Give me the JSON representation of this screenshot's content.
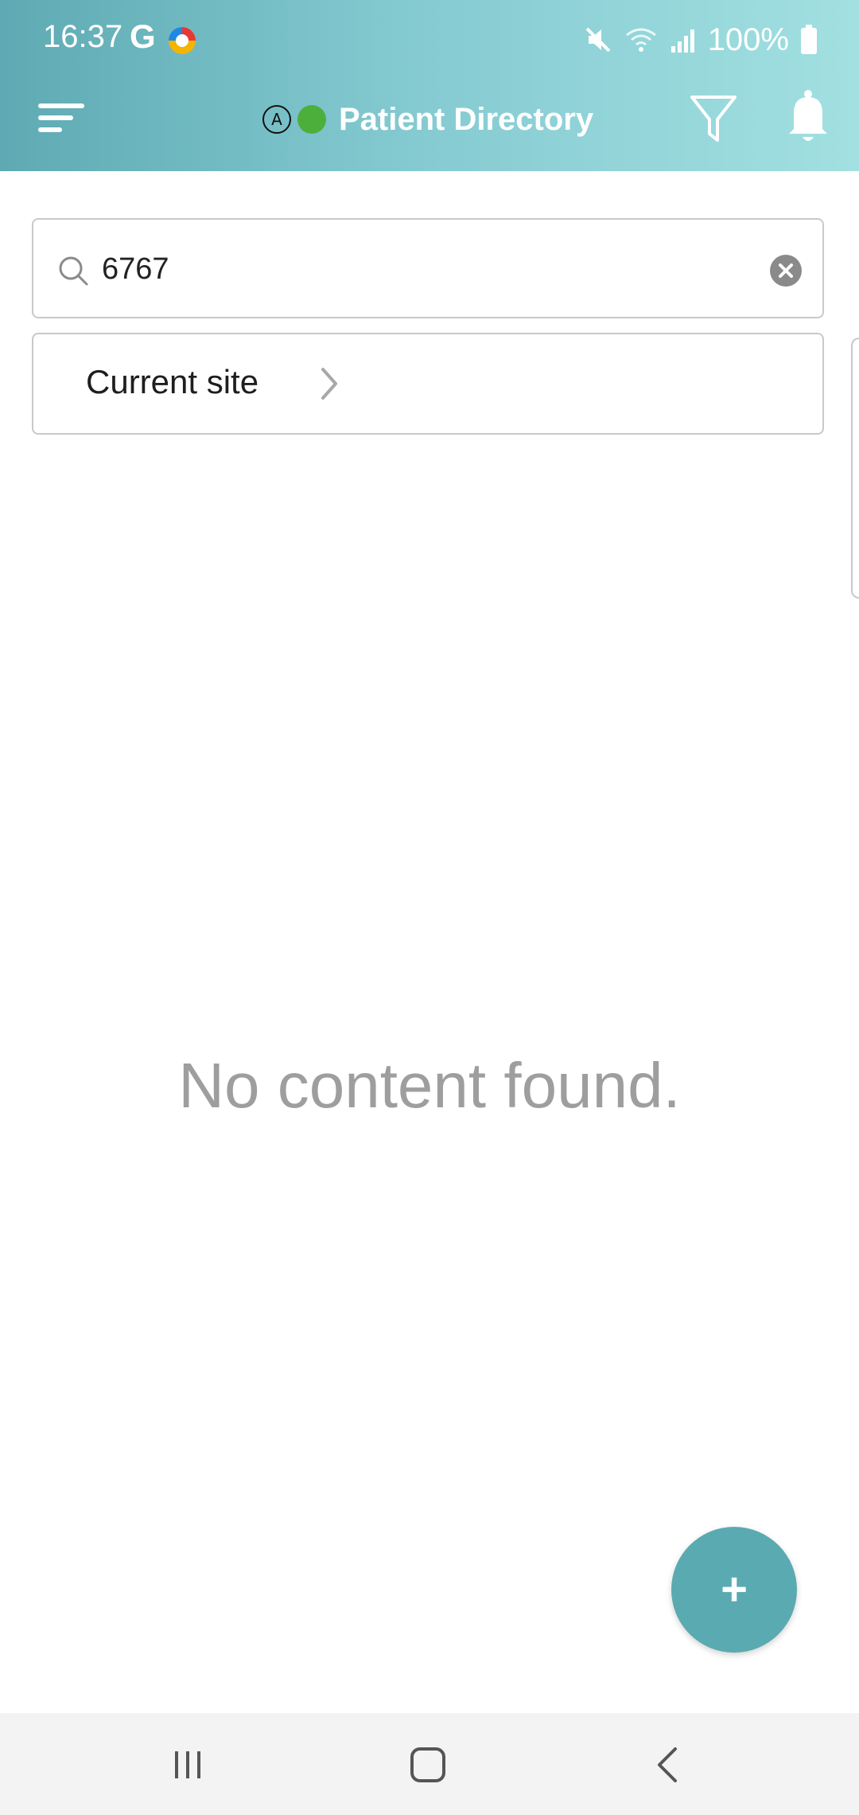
{
  "status_bar": {
    "time": "16:37",
    "google_glyph": "G",
    "battery": "100%",
    "icons": [
      "google-icon",
      "app-notification-icon",
      "mute-icon",
      "wifi-icon",
      "signal-icon",
      "battery-icon"
    ]
  },
  "app_bar": {
    "title": "Patient Directory",
    "auto_badge": "A",
    "icons": [
      "menu-icon",
      "status-online-icon",
      "filter-icon",
      "bell-icon"
    ],
    "online_color": "#4caf3c"
  },
  "search": {
    "value": "6767",
    "placeholder": ""
  },
  "site_selector": {
    "label": "Current site"
  },
  "empty_state": {
    "message": "No content found."
  },
  "fab": {
    "label": "+"
  },
  "colors": {
    "header_start": "#5eaab3",
    "header_end": "#a2e0e1",
    "accent": "#5aaab1"
  },
  "nav_bar": {
    "buttons": [
      "recents-icon",
      "home-icon",
      "back-icon"
    ]
  }
}
